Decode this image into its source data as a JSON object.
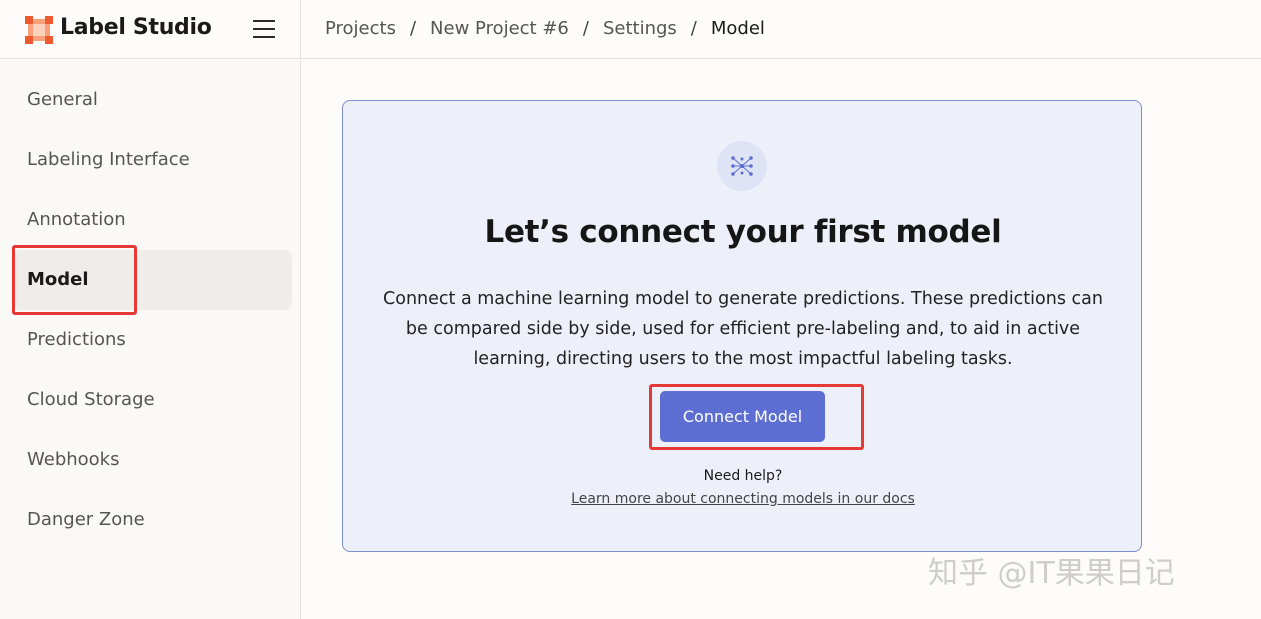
{
  "app": {
    "brand_name": "Label Studio",
    "logo_icon": "label-studio-logo-icon",
    "accent_color": "#5c6ed1",
    "highlight_color": "#e53935"
  },
  "breadcrumb": {
    "items": [
      "Projects",
      "New Project #6",
      "Settings",
      "Model"
    ],
    "separator": "/"
  },
  "sidebar": {
    "items": [
      {
        "label": "General",
        "active": false
      },
      {
        "label": "Labeling Interface",
        "active": false
      },
      {
        "label": "Annotation",
        "active": false
      },
      {
        "label": "Model",
        "active": true
      },
      {
        "label": "Predictions",
        "active": false
      },
      {
        "label": "Cloud Storage",
        "active": false
      },
      {
        "label": "Webhooks",
        "active": false
      },
      {
        "label": "Danger Zone",
        "active": false
      }
    ]
  },
  "main": {
    "icon": "model-network-icon",
    "title": "Let’s connect your first model",
    "description": "Connect a machine learning model to generate predictions. These predictions can be compared side by side, used for efficient pre-labeling and, to aid in active learning, directing users to the most impactful labeling tasks.",
    "connect_button": "Connect Model",
    "help_text": "Need help?",
    "docs_link": "Learn more about connecting models in our docs"
  },
  "watermark": "知乎 @IT果果日记"
}
